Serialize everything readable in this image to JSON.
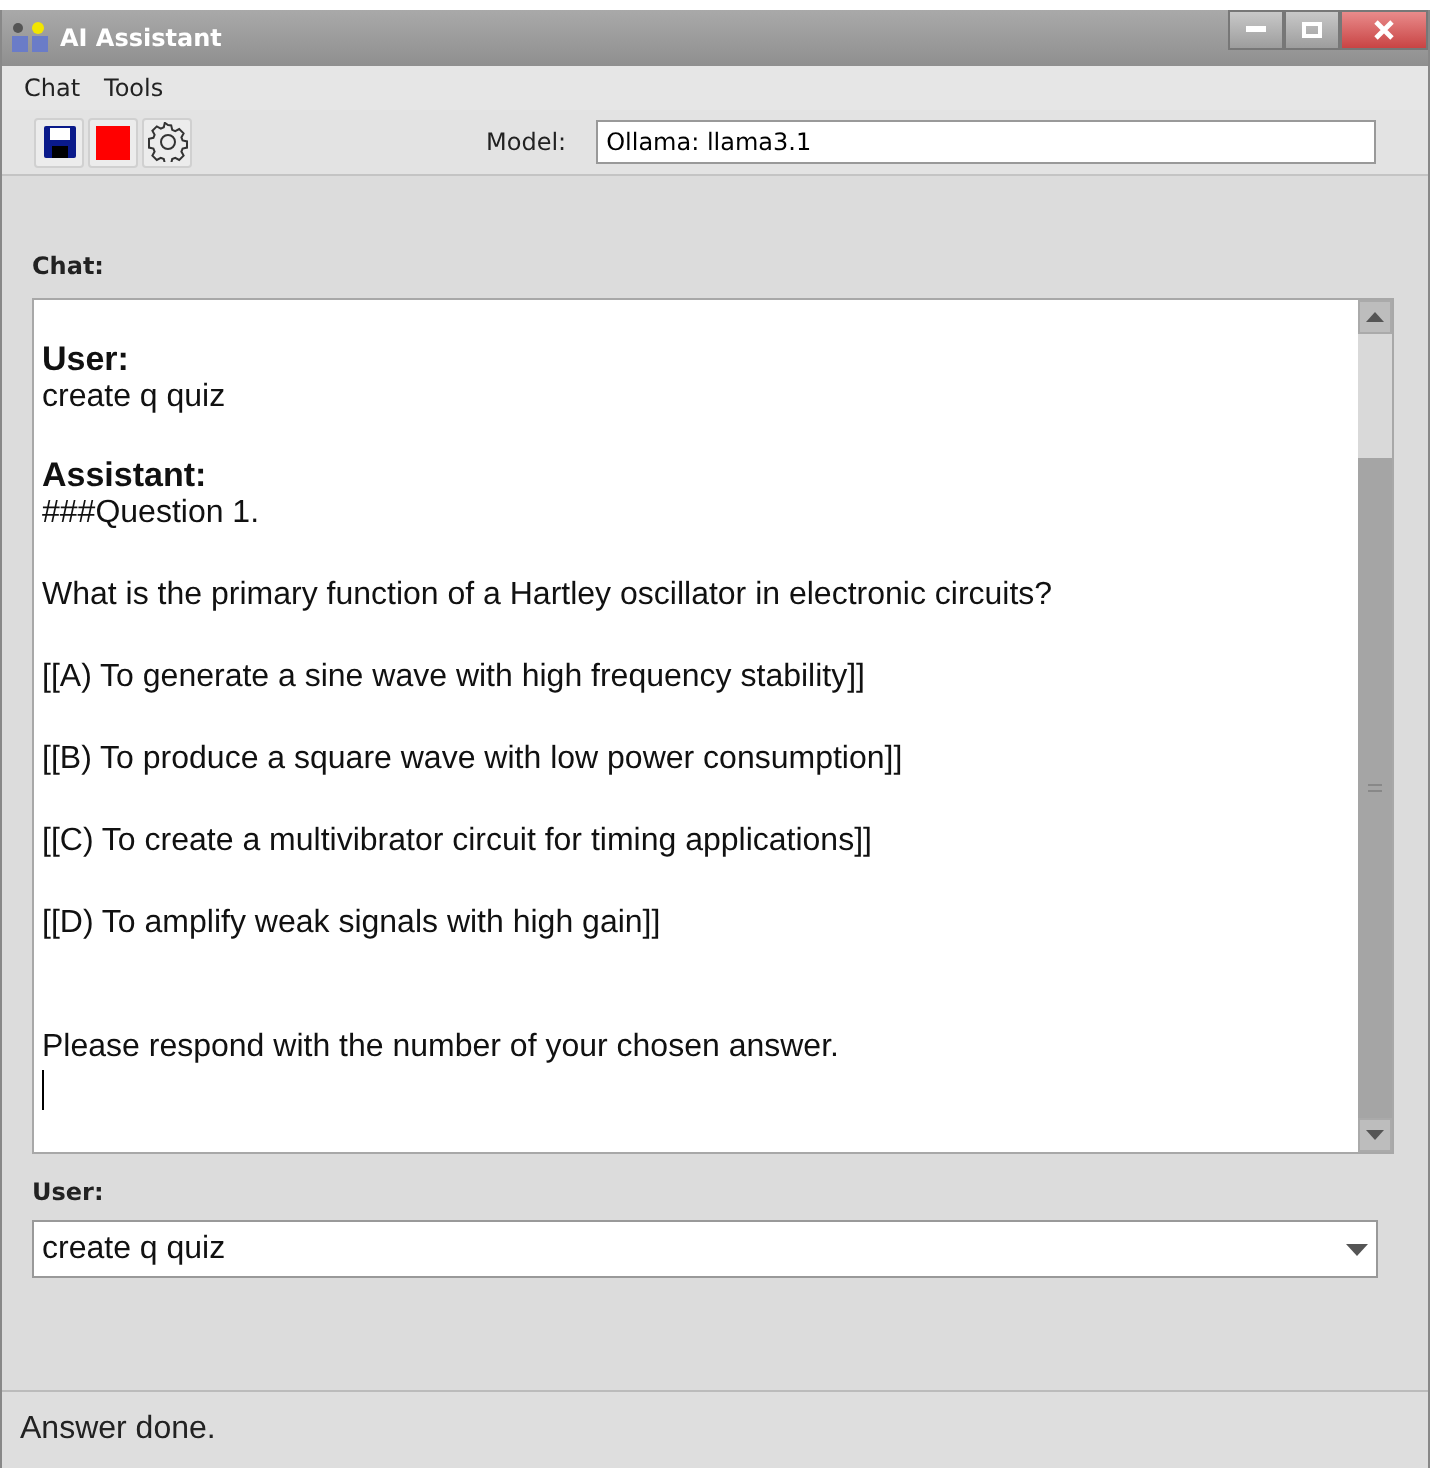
{
  "window": {
    "title": "AI Assistant"
  },
  "menu": [
    "Chat",
    "Tools"
  ],
  "toolbar": {
    "model_label": "Model:",
    "model_value": "Ollama: llama3.1"
  },
  "chat": {
    "label": "Chat:",
    "messages": [
      {
        "role": "User:",
        "paragraphs": [
          "create q quiz"
        ]
      },
      {
        "role": "Assistant:",
        "paragraphs": [
          "###Question 1.",
          "What is the primary function of a Hartley oscillator in electronic circuits?",
          "[[A) To generate a sine wave with high frequency stability]]",
          "[[B) To produce a square wave with low power consumption]]",
          "[[C) To create a multivibrator circuit for timing applications]]",
          "[[D) To amplify weak signals with high gain]]",
          "Please respond with the number of your chosen answer."
        ]
      }
    ]
  },
  "input": {
    "label": "User:",
    "value": "create q quiz"
  },
  "status_bar": "Answer done."
}
